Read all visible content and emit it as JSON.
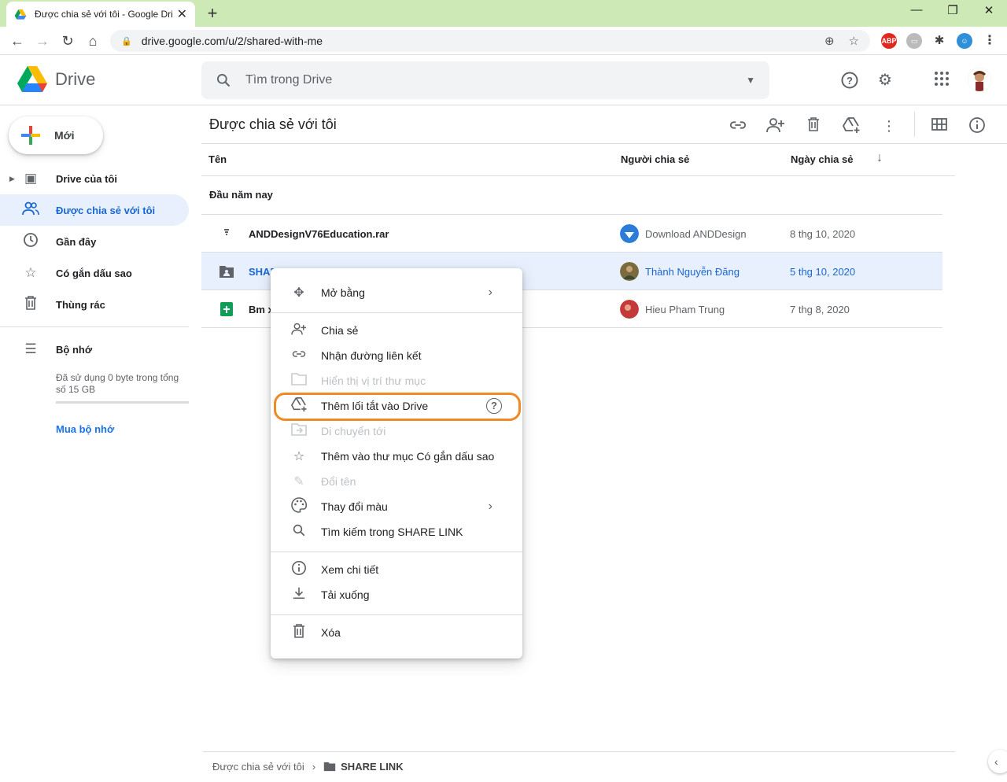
{
  "browser": {
    "tab_title": "Được chia sẻ với tôi - Google Dri",
    "url": "drive.google.com/u/2/shared-with-me"
  },
  "header": {
    "app_name": "Drive",
    "search_placeholder": "Tìm trong Drive"
  },
  "sidebar": {
    "new_label": "Mới",
    "items": [
      {
        "label": "Drive của tôi",
        "icon": "my-drive-icon"
      },
      {
        "label": "Được chia sẻ với tôi",
        "icon": "shared-icon"
      },
      {
        "label": "Gần đây",
        "icon": "clock-icon"
      },
      {
        "label": "Có gắn dấu sao",
        "icon": "star-icon"
      },
      {
        "label": "Thùng rác",
        "icon": "trash-icon"
      }
    ],
    "storage_label": "Bộ nhớ",
    "storage_text": "Đã sử dụng 0 byte trong tổng số 15 GB",
    "buy_storage": "Mua bộ nhớ"
  },
  "main": {
    "title": "Được chia sẻ với tôi",
    "columns": {
      "name": "Tên",
      "owner": "Người chia sẻ",
      "date": "Ngày chia sẻ"
    },
    "group_label": "Đầu năm nay",
    "rows": [
      {
        "name": "ANDDesignV76Education.rar",
        "owner": "Download ANDDesign",
        "date": "8 thg 10, 2020"
      },
      {
        "name": "SHAR",
        "owner": "Thành Nguyễn Đăng",
        "date": "5 thg 10, 2020"
      },
      {
        "name": "Bm x",
        "owner": "Hieu Pham Trung",
        "date": "7 thg 8, 2020"
      }
    ]
  },
  "context_menu": {
    "items": [
      {
        "label": "Mở bằng",
        "icon": "move-icon"
      },
      {
        "label": "Chia sẻ",
        "icon": "add-person-icon"
      },
      {
        "label": "Nhận đường liên kết",
        "icon": "link-icon"
      },
      {
        "label": "Hiển thị vị trí thư mục",
        "icon": "folder-icon"
      },
      {
        "label": "Thêm lối tắt vào Drive",
        "icon": "drive-shortcut-icon"
      },
      {
        "label": "Di chuyển tới",
        "icon": "move-to-icon"
      },
      {
        "label": "Thêm vào thư mục Có gắn dấu sao",
        "icon": "star-icon"
      },
      {
        "label": "Đổi tên",
        "icon": "pencil-icon"
      },
      {
        "label": "Thay đổi màu",
        "icon": "palette-icon"
      },
      {
        "label": "Tìm kiếm trong SHARE LINK",
        "icon": "search-icon"
      },
      {
        "label": "Xem chi tiết",
        "icon": "info-icon"
      },
      {
        "label": "Tải xuống",
        "icon": "download-icon"
      },
      {
        "label": "Xóa",
        "icon": "trash-icon"
      }
    ]
  },
  "breadcrumb": {
    "root": "Được chia sẻ với tôi",
    "current": "SHARE LINK"
  },
  "colors": {
    "accent": "#1967d2",
    "selected_bg": "#e8f0fe",
    "highlight": "#f08a24",
    "tab_bar": "#cde9b5"
  }
}
